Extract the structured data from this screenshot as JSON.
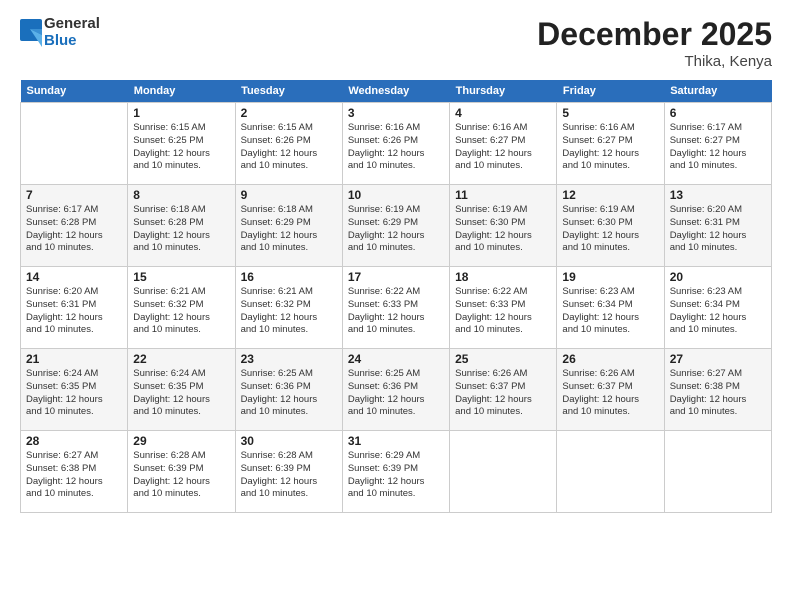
{
  "logo": {
    "general": "General",
    "blue": "Blue"
  },
  "title": "December 2025",
  "location": "Thika, Kenya",
  "days_of_week": [
    "Sunday",
    "Monday",
    "Tuesday",
    "Wednesday",
    "Thursday",
    "Friday",
    "Saturday"
  ],
  "weeks": [
    [
      {
        "num": "",
        "info": ""
      },
      {
        "num": "1",
        "info": "Sunrise: 6:15 AM\nSunset: 6:25 PM\nDaylight: 12 hours\nand 10 minutes."
      },
      {
        "num": "2",
        "info": "Sunrise: 6:15 AM\nSunset: 6:26 PM\nDaylight: 12 hours\nand 10 minutes."
      },
      {
        "num": "3",
        "info": "Sunrise: 6:16 AM\nSunset: 6:26 PM\nDaylight: 12 hours\nand 10 minutes."
      },
      {
        "num": "4",
        "info": "Sunrise: 6:16 AM\nSunset: 6:27 PM\nDaylight: 12 hours\nand 10 minutes."
      },
      {
        "num": "5",
        "info": "Sunrise: 6:16 AM\nSunset: 6:27 PM\nDaylight: 12 hours\nand 10 minutes."
      },
      {
        "num": "6",
        "info": "Sunrise: 6:17 AM\nSunset: 6:27 PM\nDaylight: 12 hours\nand 10 minutes."
      }
    ],
    [
      {
        "num": "7",
        "info": "Sunrise: 6:17 AM\nSunset: 6:28 PM\nDaylight: 12 hours\nand 10 minutes."
      },
      {
        "num": "8",
        "info": "Sunrise: 6:18 AM\nSunset: 6:28 PM\nDaylight: 12 hours\nand 10 minutes."
      },
      {
        "num": "9",
        "info": "Sunrise: 6:18 AM\nSunset: 6:29 PM\nDaylight: 12 hours\nand 10 minutes."
      },
      {
        "num": "10",
        "info": "Sunrise: 6:19 AM\nSunset: 6:29 PM\nDaylight: 12 hours\nand 10 minutes."
      },
      {
        "num": "11",
        "info": "Sunrise: 6:19 AM\nSunset: 6:30 PM\nDaylight: 12 hours\nand 10 minutes."
      },
      {
        "num": "12",
        "info": "Sunrise: 6:19 AM\nSunset: 6:30 PM\nDaylight: 12 hours\nand 10 minutes."
      },
      {
        "num": "13",
        "info": "Sunrise: 6:20 AM\nSunset: 6:31 PM\nDaylight: 12 hours\nand 10 minutes."
      }
    ],
    [
      {
        "num": "14",
        "info": "Sunrise: 6:20 AM\nSunset: 6:31 PM\nDaylight: 12 hours\nand 10 minutes."
      },
      {
        "num": "15",
        "info": "Sunrise: 6:21 AM\nSunset: 6:32 PM\nDaylight: 12 hours\nand 10 minutes."
      },
      {
        "num": "16",
        "info": "Sunrise: 6:21 AM\nSunset: 6:32 PM\nDaylight: 12 hours\nand 10 minutes."
      },
      {
        "num": "17",
        "info": "Sunrise: 6:22 AM\nSunset: 6:33 PM\nDaylight: 12 hours\nand 10 minutes."
      },
      {
        "num": "18",
        "info": "Sunrise: 6:22 AM\nSunset: 6:33 PM\nDaylight: 12 hours\nand 10 minutes."
      },
      {
        "num": "19",
        "info": "Sunrise: 6:23 AM\nSunset: 6:34 PM\nDaylight: 12 hours\nand 10 minutes."
      },
      {
        "num": "20",
        "info": "Sunrise: 6:23 AM\nSunset: 6:34 PM\nDaylight: 12 hours\nand 10 minutes."
      }
    ],
    [
      {
        "num": "21",
        "info": "Sunrise: 6:24 AM\nSunset: 6:35 PM\nDaylight: 12 hours\nand 10 minutes."
      },
      {
        "num": "22",
        "info": "Sunrise: 6:24 AM\nSunset: 6:35 PM\nDaylight: 12 hours\nand 10 minutes."
      },
      {
        "num": "23",
        "info": "Sunrise: 6:25 AM\nSunset: 6:36 PM\nDaylight: 12 hours\nand 10 minutes."
      },
      {
        "num": "24",
        "info": "Sunrise: 6:25 AM\nSunset: 6:36 PM\nDaylight: 12 hours\nand 10 minutes."
      },
      {
        "num": "25",
        "info": "Sunrise: 6:26 AM\nSunset: 6:37 PM\nDaylight: 12 hours\nand 10 minutes."
      },
      {
        "num": "26",
        "info": "Sunrise: 6:26 AM\nSunset: 6:37 PM\nDaylight: 12 hours\nand 10 minutes."
      },
      {
        "num": "27",
        "info": "Sunrise: 6:27 AM\nSunset: 6:38 PM\nDaylight: 12 hours\nand 10 minutes."
      }
    ],
    [
      {
        "num": "28",
        "info": "Sunrise: 6:27 AM\nSunset: 6:38 PM\nDaylight: 12 hours\nand 10 minutes."
      },
      {
        "num": "29",
        "info": "Sunrise: 6:28 AM\nSunset: 6:39 PM\nDaylight: 12 hours\nand 10 minutes."
      },
      {
        "num": "30",
        "info": "Sunrise: 6:28 AM\nSunset: 6:39 PM\nDaylight: 12 hours\nand 10 minutes."
      },
      {
        "num": "31",
        "info": "Sunrise: 6:29 AM\nSunset: 6:39 PM\nDaylight: 12 hours\nand 10 minutes."
      },
      {
        "num": "",
        "info": ""
      },
      {
        "num": "",
        "info": ""
      },
      {
        "num": "",
        "info": ""
      }
    ]
  ]
}
